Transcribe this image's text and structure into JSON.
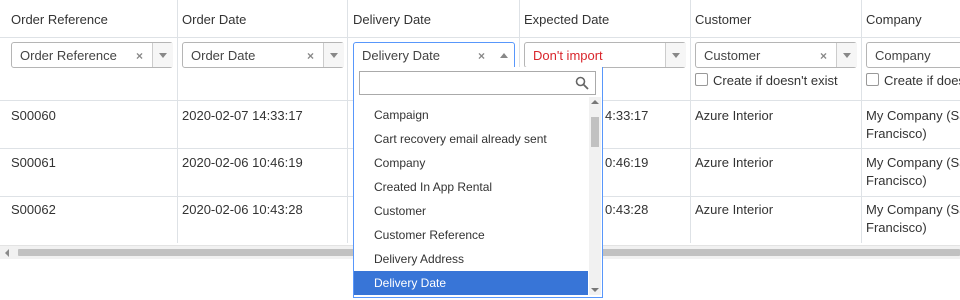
{
  "columns": [
    {
      "header": "Order Reference",
      "mapping": "Order Reference",
      "clear": "×"
    },
    {
      "header": "Order Date",
      "mapping": "Order Date",
      "clear": "×"
    },
    {
      "header": "Delivery Date",
      "mapping": "Delivery Date",
      "clear": "×"
    },
    {
      "header": "Expected Date",
      "mapping": "Don't import"
    },
    {
      "header": "Customer",
      "mapping": "Customer",
      "clear": "×",
      "create_label": "Create if doesn't exist"
    },
    {
      "header": "Company",
      "mapping": "Company",
      "create_label": "Create if does"
    }
  ],
  "rows": [
    {
      "ref": "S00060",
      "order_date": "2020-02-07 14:33:17",
      "expected": "4:33:17",
      "customer": "Azure Interior",
      "company_l1": "My Company (Sa",
      "company_l2": "Francisco)"
    },
    {
      "ref": "S00061",
      "order_date": "2020-02-06 10:46:19",
      "expected": "0:46:19",
      "customer": "Azure Interior",
      "company_l1": "My Company (Sa",
      "company_l2": "Francisco)"
    },
    {
      "ref": "S00062",
      "order_date": "2020-02-06 10:43:28",
      "expected": "0:43:28",
      "customer": "Azure Interior",
      "company_l1": "My Company (Sa",
      "company_l2": "Francisco)"
    }
  ],
  "dropdown": {
    "search_placeholder": "",
    "options": [
      "Campaign",
      "Cart recovery email already sent",
      "Company",
      "Created In App Rental",
      "Customer",
      "Customer Reference",
      "Delivery Address",
      "Delivery Date"
    ],
    "selected": "Delivery Date"
  },
  "colors": {
    "accent": "#5897fb",
    "selected": "#3875d7",
    "warning": "#d9262c"
  }
}
